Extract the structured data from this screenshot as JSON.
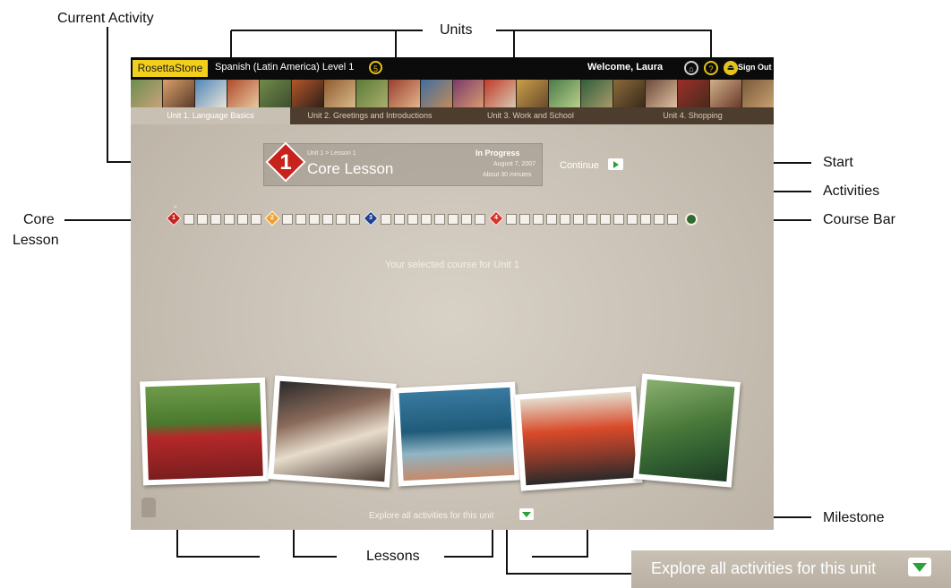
{
  "annotations": {
    "current_activity": "Current Activity",
    "units": "Units",
    "start": "Start",
    "activities": "Activities",
    "core": "Core",
    "lesson": "Lesson",
    "course_bar": "Course Bar",
    "lessons": "Lessons",
    "milestone": "Milestone"
  },
  "app": {
    "logo": "RosettaStone",
    "course_title": "Spanish (Latin America) Level 1",
    "level_badge": "5",
    "welcome": "Welcome, Laura",
    "sign_out": "Sign Out",
    "icons": [
      "home-icon",
      "help-icon",
      "exit-icon"
    ]
  },
  "unit_tabs": [
    "Unit 1. Language Basics",
    "Unit 2. Greetings and Introductions",
    "Unit 3. Work and School",
    "Unit 4. Shopping"
  ],
  "lesson_card": {
    "breadcrumb": "Unit 1 > Lesson 1",
    "title": "Core Lesson",
    "number": "1",
    "status": "In Progress",
    "date": "August 7, 2007",
    "duration": "About 30 minutes",
    "continue": "Continue"
  },
  "course_bar": {
    "lessons": [
      {
        "number": "1",
        "color": "#c7231c"
      },
      {
        "number": "2",
        "color": "#f0a030"
      },
      {
        "number": "3",
        "color": "#1f3f8f"
      },
      {
        "number": "4",
        "color": "#d8352b"
      }
    ]
  },
  "selected_course": "Your selected course for Unit 1",
  "explore_label": "Explore all activities for this unit",
  "callout_label": "Explore all activities for this unit",
  "colors": {
    "accent_yellow": "#f2cf1d",
    "continue_green": "#2aa236",
    "milestone_green": "#2e6b2c"
  }
}
